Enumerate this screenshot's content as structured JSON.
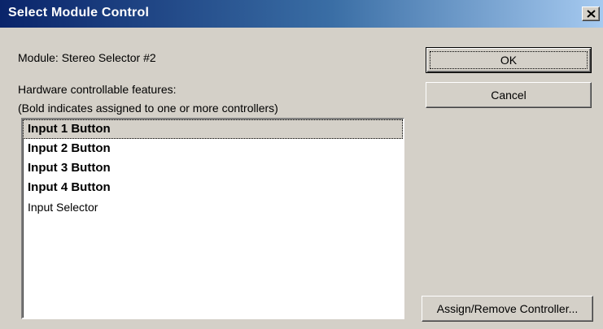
{
  "window": {
    "title": "Select Module Control",
    "close_icon": "close-icon"
  },
  "module": {
    "label": "Module:  Stereo Selector #2"
  },
  "features": {
    "heading": "Hardware controllable features:",
    "hint": "(Bold indicates assigned to one or more controllers)",
    "items": [
      {
        "label": "Input 1 Button",
        "bold": true,
        "selected": true
      },
      {
        "label": "Input 2 Button",
        "bold": true,
        "selected": false
      },
      {
        "label": "Input 3 Button",
        "bold": true,
        "selected": false
      },
      {
        "label": "Input 4 Button",
        "bold": true,
        "selected": false
      },
      {
        "label": "Input Selector",
        "bold": false,
        "selected": false
      }
    ]
  },
  "buttons": {
    "ok": "OK",
    "cancel": "Cancel",
    "assign": "Assign/Remove Controller..."
  }
}
